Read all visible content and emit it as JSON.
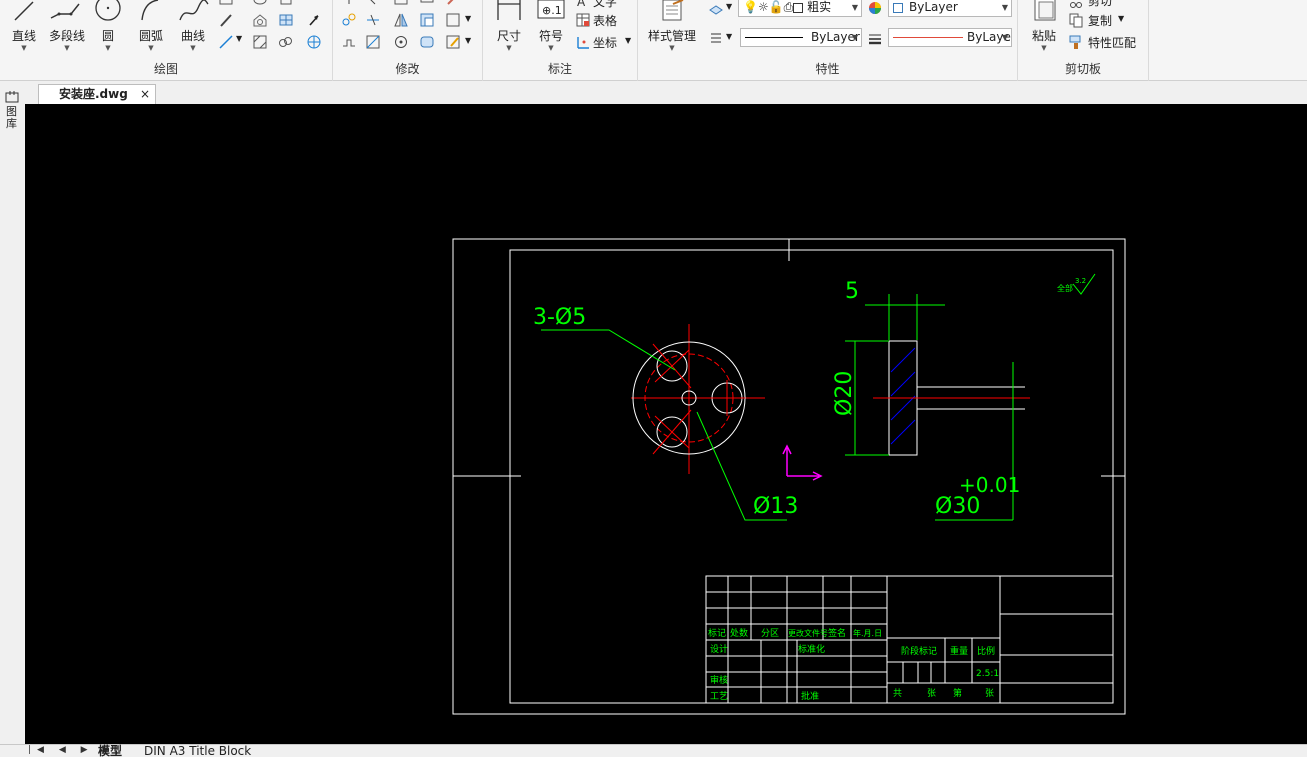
{
  "ribbon": {
    "draw": {
      "title": "绘图",
      "line": "直线",
      "polyline": "多段线",
      "circle": "圆",
      "arc": "圆弧",
      "curve": "曲线"
    },
    "modify": {
      "title": "修改"
    },
    "annotate": {
      "title": "标注",
      "dimension": "尺寸",
      "symbol": "符号",
      "text": "文字",
      "table": "表格",
      "coord": "坐标"
    },
    "properties": {
      "title": "特性",
      "style_manager": "样式管理",
      "layer_name": "粗实",
      "color_value": "ByLayer",
      "linetype_value": "ByLayer",
      "lineweight_value": "ByLayer"
    },
    "clipboard": {
      "title": "剪切板",
      "paste": "粘贴",
      "cut": "剪切",
      "copy": "复制",
      "match": "特性匹配"
    }
  },
  "document": {
    "tab_name": "安装座.dwg",
    "close": "×",
    "side_label": "图库"
  },
  "drawing": {
    "dim_holes": "3-Ø5",
    "dim_bolt_circle": "Ø13",
    "dim_width": "5",
    "dim_dia20": "Ø20",
    "dim_dia30": "Ø30",
    "dim_tol": "+0.01",
    "roughness_label": "全部",
    "roughness_value": "3.2",
    "title_block": {
      "mark": "标记",
      "count": "处数",
      "zone": "分区",
      "doc_no": "更改文件号",
      "sign": "签名",
      "date": "年.月.日",
      "design": "设计",
      "standard": "标准化",
      "review": "审核",
      "process": "工艺",
      "approve": "批准",
      "stage": "阶段标记",
      "weight": "重量",
      "scale": "比例",
      "scale_val": "2.5:1",
      "total": "共",
      "sheets": "张",
      "page": "第",
      "sheet2": "张"
    }
  },
  "layouts": {
    "model": "模型",
    "sheet": "DIN A3 Title Block"
  },
  "colors": {
    "canvas": "#000000",
    "green": "#00ff00",
    "red": "#ff0000",
    "white": "#ffffff",
    "blue": "#0000ff",
    "magenta": "#ff00ff"
  }
}
